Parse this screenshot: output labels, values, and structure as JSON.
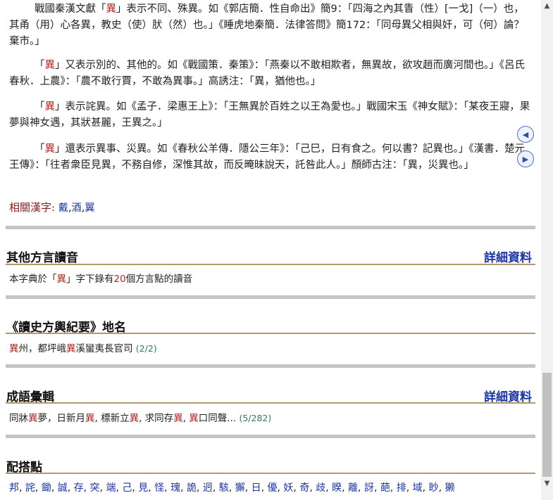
{
  "paragraphs": [
    {
      "pre": "戰國秦漢文獻「",
      "char": "異",
      "post": "」表示不同、殊異。如《郭店簡．性自命出》簡9：「四海之內其眚（性）[一戈]（一）也，其甬（用）心各異，教史（使）肰（然）也。」《睡虎地秦簡．法律答問》簡172：「同母異父相與奸，可（何）論？棄市。」"
    },
    {
      "pre": "「",
      "char": "異",
      "post": "」又表示別的、其他的。如《戰國策．秦策》：「燕秦以不敢相欺者，無異故，欲攻趙而廣河間也。」《呂氏春秋．上農》：「農不敢行賈，不敢為異事。」高誘注：「異，猶他也。」"
    },
    {
      "pre": "「",
      "char": "異",
      "post": "」表示詫異。如《孟子．梁惠王上》：「王無異於百姓之以王為愛也。」戰國宋玉《神女賦》：「某夜王寢，果夢與神女遇，其狀甚麗，王異之。」"
    },
    {
      "pre": "「",
      "char": "異",
      "post": "」還表示異事、災異。如《春秋公羊傳．隱公三年》：「己巳，日有食之。何以書？記異也。」《漢書．楚元王傳》：「往者衆臣見異，不務自修，深惟其故，而反晻昧說天，託咎此人。」顏師古注：「異，災異也。」"
    }
  ],
  "related": {
    "label": "相關漢字:",
    "items": [
      "戴",
      "酒",
      "翼"
    ]
  },
  "dialect": {
    "title": "其他方言讀音",
    "link": "詳細資料",
    "text_pre": "本字典於「",
    "char": "異",
    "text_mid": "」字下錄有",
    "count": "20",
    "text_post": "個方言點的讀音"
  },
  "place": {
    "title": "《讀史方輿紀要》地名",
    "char": "異",
    "text_mid": "州，都坪峨",
    "char2": "異",
    "text_post": "溪蠻夷長官司",
    "count": "(2/2)"
  },
  "idioms": {
    "title": "成語彙輯",
    "link": "詳細資料",
    "items": [
      {
        "pre": "同牀",
        "char": "異",
        "post": "夢"
      },
      {
        "pre": "日新月",
        "char": "異",
        "post": ""
      },
      {
        "pre": "標新立",
        "char": "異",
        "post": ""
      },
      {
        "pre": "求同存",
        "char": "異",
        "post": ""
      },
      {
        "pre": "",
        "char": "異",
        "post": "口同聲"
      }
    ],
    "ellipsis": "...",
    "count": "(5/282)"
  },
  "collocation": {
    "title": "配搭點",
    "items": [
      "邦",
      "詫",
      "鋤",
      "誠",
      "存",
      "突",
      "端",
      "己",
      "見",
      "怪",
      "瑰",
      "詭",
      "迥",
      "駭",
      "獬",
      "日",
      "優",
      "妖",
      "奇",
      "歧",
      "睽",
      "離",
      "訝",
      "葩",
      "排",
      "域",
      "眇",
      "獭"
    ]
  },
  "nav": {
    "prev": "◀",
    "next": "▶"
  },
  "scroll": {
    "up": "▲",
    "down": "▼"
  }
}
